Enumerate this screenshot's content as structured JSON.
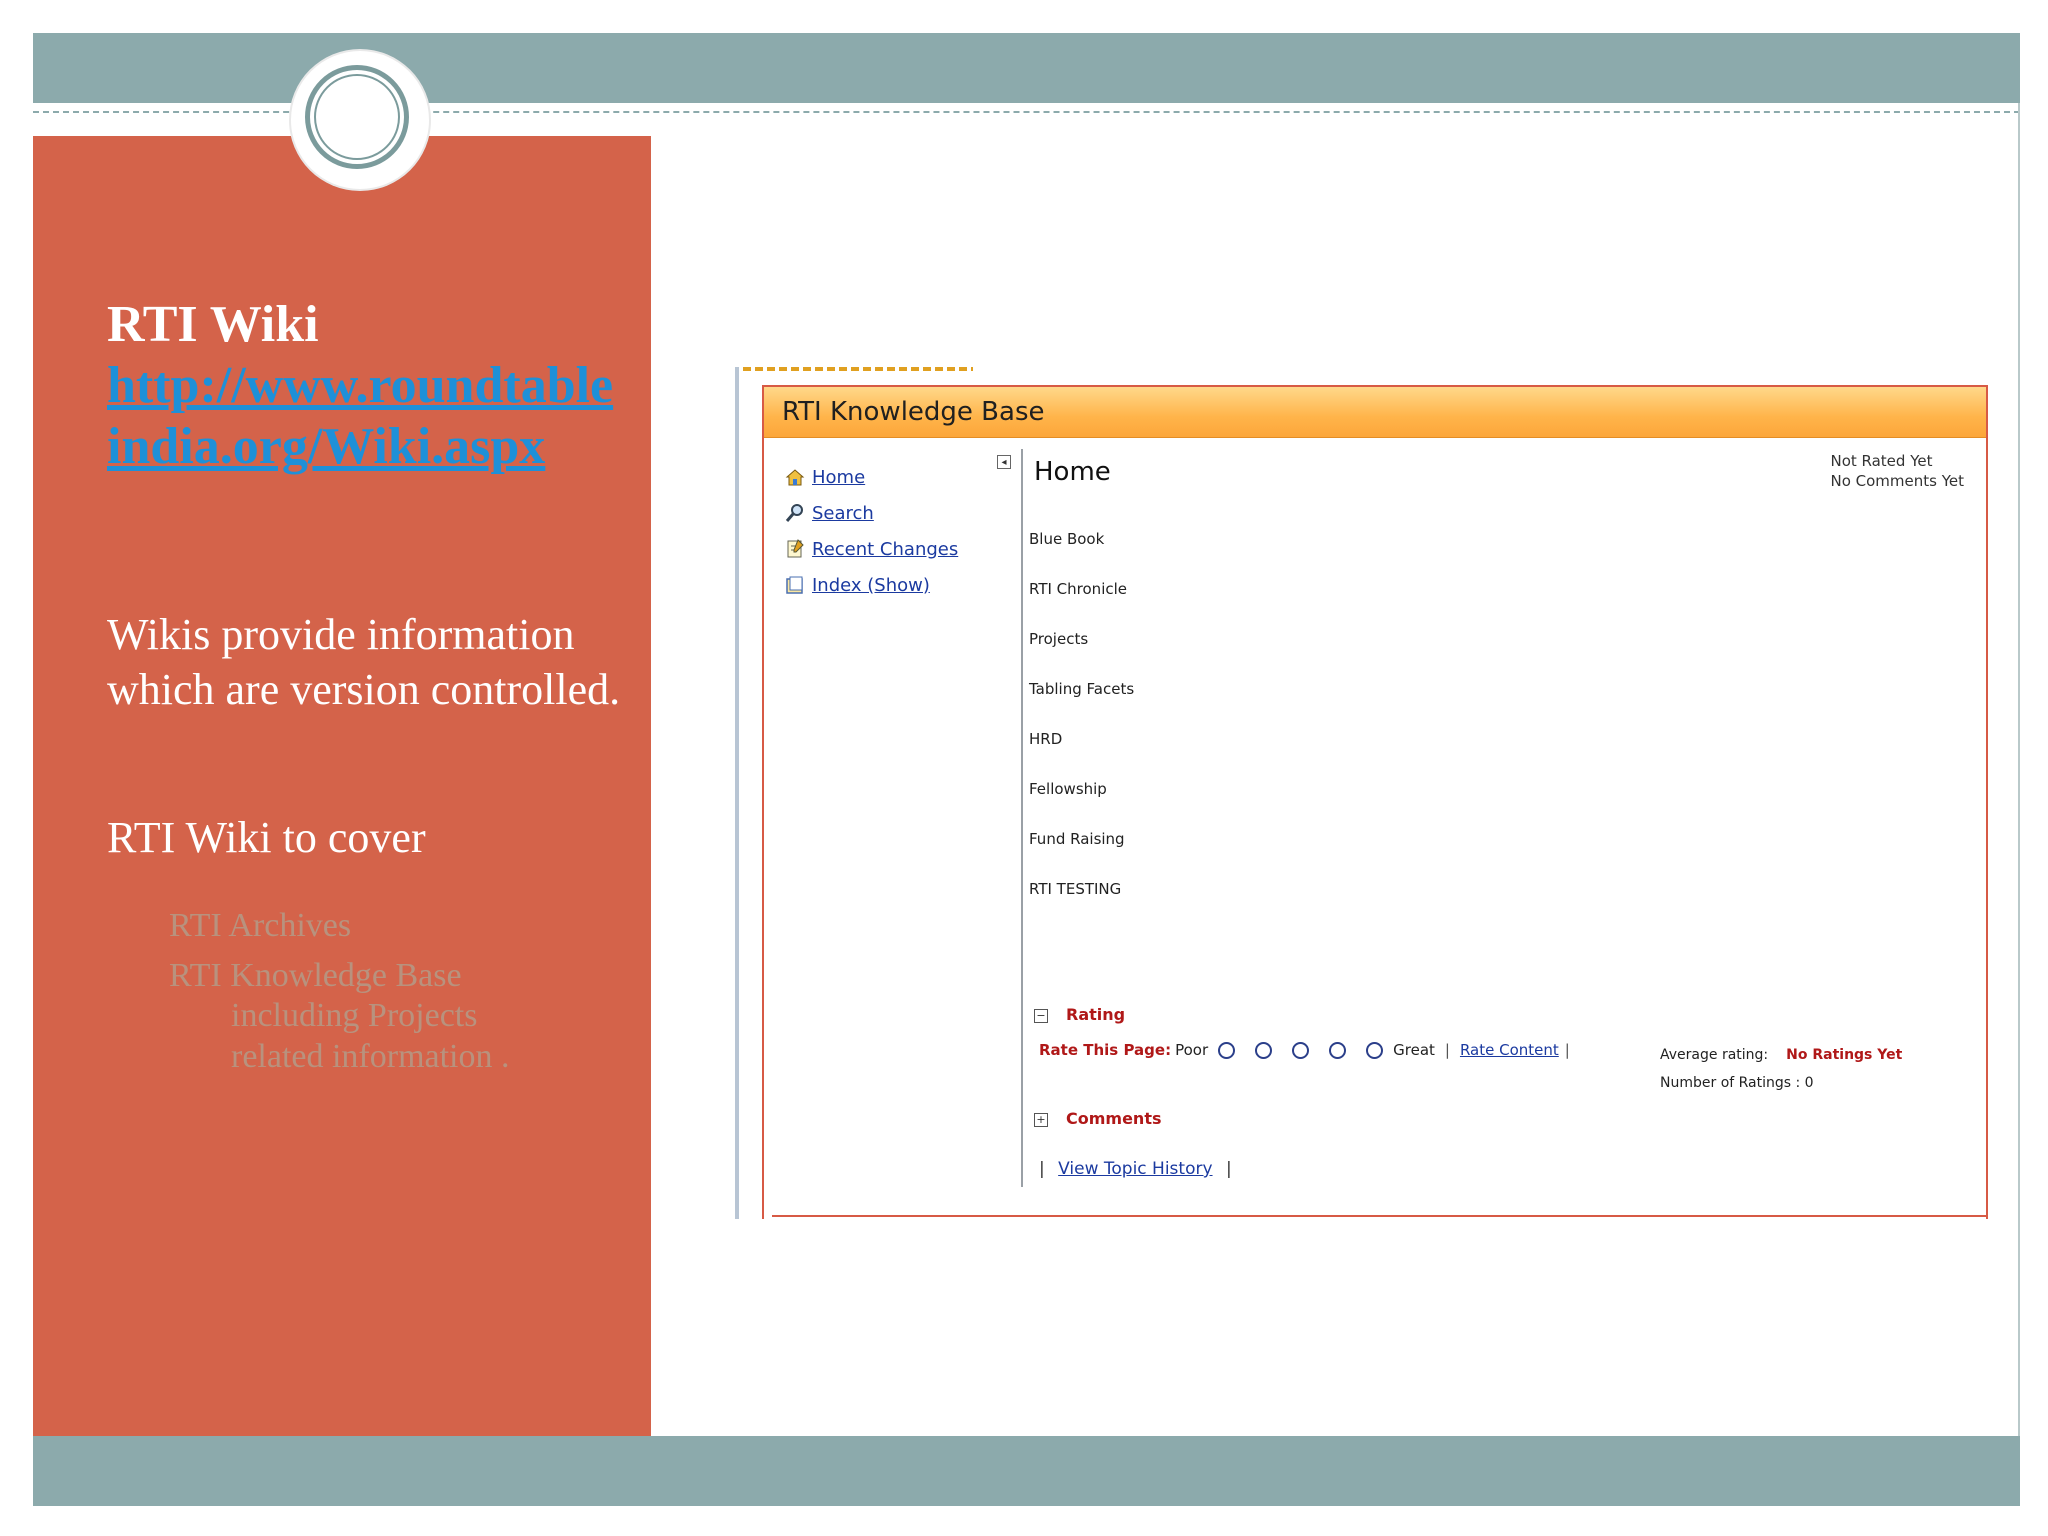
{
  "left_panel": {
    "title": "RTI Wiki",
    "link": "http://www.roundtableindia.org/Wiki.aspx",
    "paragraph1": "Wikis provide information which are version controlled.",
    "paragraph2": "RTI Wiki to cover",
    "bullets": [
      "RTI Archives",
      "RTI Knowledge Base",
      "including Projects  related information ."
    ]
  },
  "kb": {
    "title": "RTI Knowledge Base",
    "nav": [
      {
        "label": "Home",
        "icon": "home-icon"
      },
      {
        "label": "Search",
        "icon": "search-icon"
      },
      {
        "label": "Recent Changes",
        "icon": "recent-changes-icon"
      },
      {
        "label": "Index (Show)",
        "icon": "index-icon"
      }
    ],
    "collapse_symbol": "◂",
    "page_heading": "Home",
    "status": [
      "Not Rated Yet",
      "No Comments Yet"
    ],
    "topics": [
      "Blue Book",
      "RTI Chronicle",
      "Projects",
      "Tabling Facets",
      "HRD",
      "Fellowship",
      "Fund Raising",
      "RTI TESTING"
    ],
    "rating": {
      "header": "Rating",
      "expand_symbol": "−",
      "rate_label": "Rate This Page:",
      "poor": "Poor",
      "great": "Great",
      "rate_content": "Rate Content",
      "average_label": "Average rating:",
      "average_value": "No Ratings Yet",
      "count_label": "Number of Ratings : 0"
    },
    "comments": {
      "header": "Comments",
      "expand_symbol": "+"
    },
    "history_link": "View Topic History"
  },
  "colors": {
    "panel": "#d4634a",
    "band": "#8caaac",
    "link": "#1e90d8",
    "header_orange": "#ffb44a",
    "rating_red": "#b01818"
  }
}
